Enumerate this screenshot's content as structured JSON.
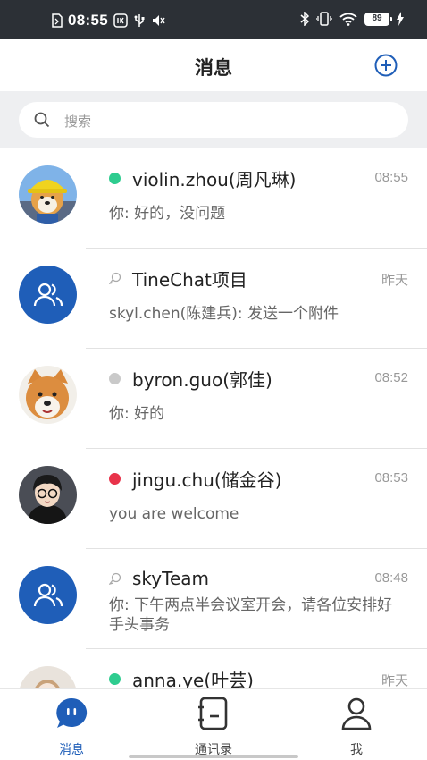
{
  "status_bar": {
    "time": "08:55",
    "battery": "89"
  },
  "header": {
    "title": "消息"
  },
  "search": {
    "placeholder": "搜索"
  },
  "conversations": [
    {
      "name": "violin.zhou(周凡琳)",
      "time": "08:55",
      "message": "你: 好的，没问题",
      "status": "online",
      "status_color": "#2ecc8f",
      "avatar": "shiba-hat-photo"
    },
    {
      "name": "TineChat项目",
      "time": "昨天",
      "message": "skyl.chen(陈建兵): 发送一个附件",
      "status": "group",
      "avatar": "group-icon"
    },
    {
      "name": "byron.guo(郭佳)",
      "time": "08:52",
      "message": "你: 好的",
      "status": "offline",
      "status_color": "#c9c9c9",
      "avatar": "shiba-photo"
    },
    {
      "name": "jingu.chu(储金谷)",
      "time": "08:53",
      "message": "you are welcome",
      "status": "busy",
      "status_color": "#e8334a",
      "avatar": "cartoon-boy"
    },
    {
      "name": "skyTeam",
      "time": "08:48",
      "message": "你: 下午两点半会议室开会，请各位安排好手头事务",
      "status": "group",
      "avatar": "group-icon"
    },
    {
      "name": "anna.ye(叶芸)",
      "time": "昨天",
      "message": "",
      "status": "online",
      "status_color": "#2ecc8f",
      "avatar": "cartoon-girl"
    }
  ],
  "tabs": [
    {
      "label": "消息",
      "icon": "chat-bubble-icon",
      "active": true
    },
    {
      "label": "通讯录",
      "icon": "contacts-icon",
      "active": false
    },
    {
      "label": "我",
      "icon": "person-icon",
      "active": false
    }
  ],
  "colors": {
    "accent": "#1f5eb8",
    "status_bar_bg": "#2c3036",
    "search_bg": "#eeeff1"
  }
}
